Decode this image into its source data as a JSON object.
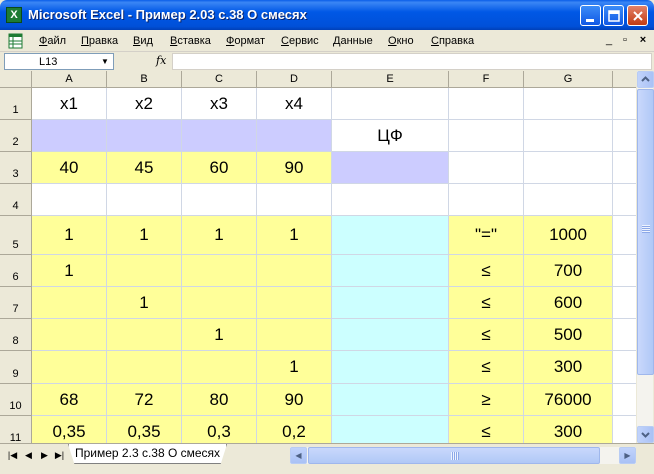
{
  "window": {
    "title": "Microsoft Excel - Пример 2.03 с.38 О смесях",
    "app_icon": "excel-icon"
  },
  "menu": {
    "items": [
      "Файл",
      "Правка",
      "Вид",
      "Вставка",
      "Формат",
      "Сервис",
      "Данные",
      "Окно",
      "Справка"
    ],
    "mdi_buttons": [
      "_",
      "▫",
      "×"
    ]
  },
  "formula_bar": {
    "name_box": "L13",
    "fx_label": "fx",
    "formula": ""
  },
  "grid": {
    "columns": [
      "A",
      "B",
      "C",
      "D",
      "E",
      "F",
      "G"
    ],
    "rows": [
      "1",
      "2",
      "3",
      "4",
      "5",
      "6",
      "7",
      "8",
      "9",
      "10",
      "11"
    ],
    "cells": {
      "A1": "x1",
      "B1": "x2",
      "C1": "x3",
      "D1": "x4",
      "E2": "ЦФ",
      "A3": "40",
      "B3": "45",
      "C3": "60",
      "D3": "90",
      "A5": "1",
      "B5": "1",
      "C5": "1",
      "D5": "1",
      "F5": "\"=\"",
      "G5": "1000",
      "A6": "1",
      "F6": "≤",
      "G6": "700",
      "B7": "1",
      "F7": "≤",
      "G7": "600",
      "C8": "1",
      "F8": "≤",
      "G8": "500",
      "D9": "1",
      "F9": "≤",
      "G9": "300",
      "A10": "68",
      "B10": "72",
      "C10": "80",
      "D10": "90",
      "F10": "≥",
      "G10": "76000",
      "A11": "0,35",
      "B11": "0,35",
      "C11": "0,3",
      "D11": "0,2",
      "F11": "≤",
      "G11": "300"
    },
    "fill_colors": {
      "yellow": "#FFFF99",
      "lavender": "#CCCCFF",
      "cyan": "#CCFFFF"
    }
  },
  "sheet_tabs": {
    "active": "Пример 2.3 с.38 О смесях"
  }
}
